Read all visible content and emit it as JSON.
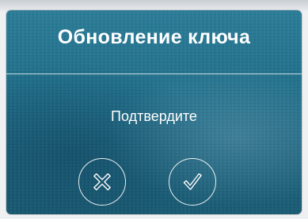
{
  "dialog": {
    "title": "Обновление ключа",
    "message": "Подтвердите",
    "cancel_icon": "cross-icon",
    "confirm_icon": "checkmark-icon",
    "accent_color": "#1f6f8b",
    "text_color": "#ffffff"
  }
}
